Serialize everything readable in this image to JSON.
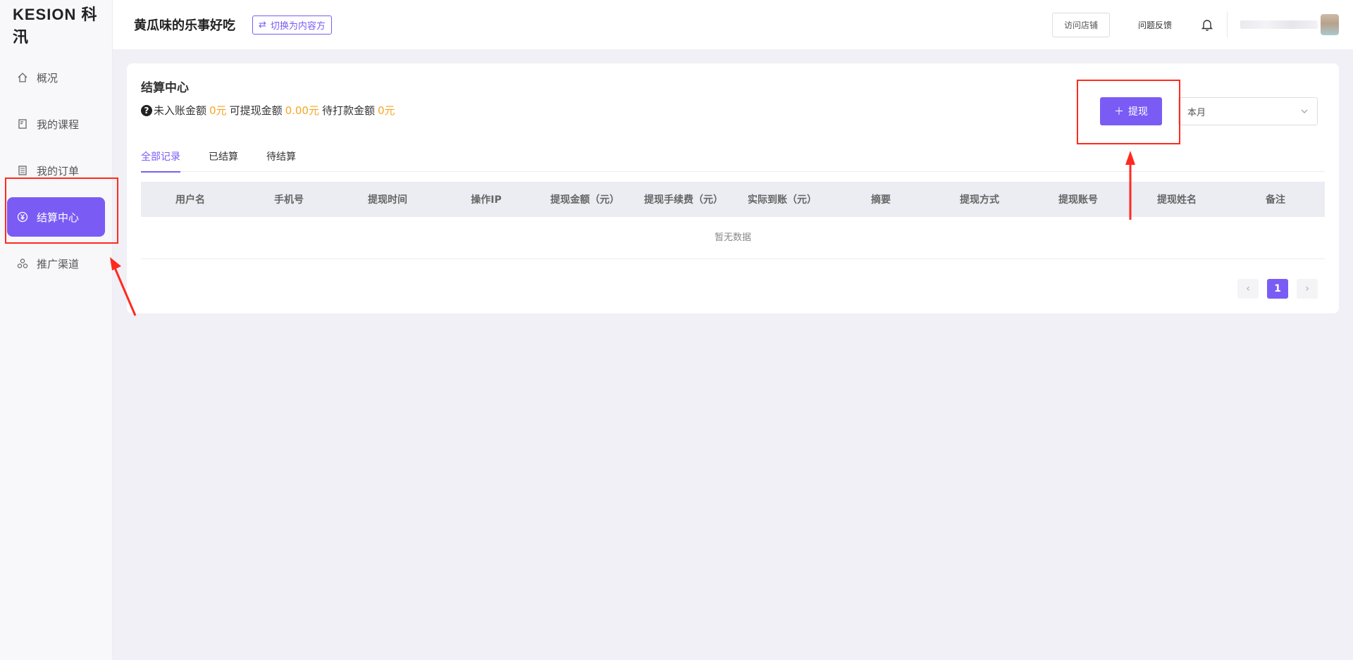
{
  "sidebar": {
    "logo": "KESION 科汛",
    "items": [
      {
        "label": "概况",
        "icon": "home-icon"
      },
      {
        "label": "我的课程",
        "icon": "course-icon"
      },
      {
        "label": "我的订单",
        "icon": "order-icon"
      },
      {
        "label": "结算中心",
        "icon": "yen-circle-icon",
        "active": true
      },
      {
        "label": "推广渠道",
        "icon": "channel-icon"
      }
    ]
  },
  "header": {
    "shop_name": "黄瓜味的乐事好吃",
    "switch_label": "切换为内容方",
    "visit_store": "访问店铺",
    "feedback": "问题反馈"
  },
  "main": {
    "title": "结算中心",
    "summary": {
      "unbooked_label": "未入账金额",
      "unbooked_value": "0元",
      "withdrawable_label": "可提现金额",
      "withdrawable_value": "0.00元",
      "pending_label": "待打款金额",
      "pending_value": "0元"
    },
    "withdraw_button": "提现",
    "period_select": "本月",
    "tabs": [
      "全部记录",
      "已结算",
      "待结算"
    ],
    "table": {
      "columns": [
        "用户名",
        "手机号",
        "提现时间",
        "操作IP",
        "提现金额（元）",
        "提现手续费（元）",
        "实际到账（元）",
        "摘要",
        "提现方式",
        "提现账号",
        "提现姓名",
        "备注"
      ],
      "empty_text": "暂无数据"
    },
    "pagination": {
      "current": "1",
      "prev": "‹",
      "next": "›"
    }
  },
  "colors": {
    "accent": "#7a5cf5",
    "amount": "#f5a623",
    "annotation": "#ff2a1f"
  }
}
